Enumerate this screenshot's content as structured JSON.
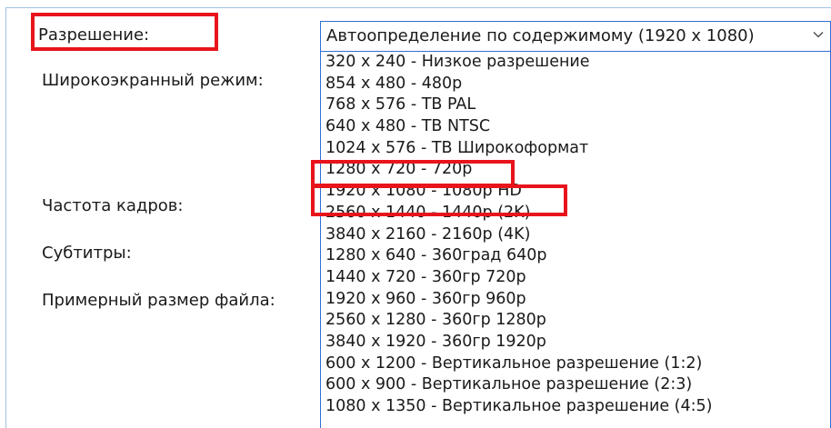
{
  "form": {
    "resolution_label": "Разрешение:",
    "widescreen_label": "Широкоэкранный режим:",
    "framerate_label": "Частота кадров:",
    "subtitles_label": "Субтитры:",
    "filesize_label": "Примерный размер файла:"
  },
  "resolution_select": {
    "selected": "Автоопределение по содержимому (1920 x 1080)",
    "options": [
      "320 x 240 - Низкое разрешение",
      "854 x 480 - 480p",
      "768 x 576 - ТВ PAL",
      "640 x 480 - ТВ NTSC",
      "1024 x 576 - ТВ Широкоформат",
      "1280 x 720 - 720p",
      "1920 x 1080 - 1080p HD",
      "2560 x 1440 - 1440p (2K)",
      "3840 x 2160 - 2160p (4K)",
      "1280 x 640 - 360град 640p",
      "1440 x 720 - 360гр 720p",
      "1920 x 960 - 360гр 960p",
      "2560 x 1280 - 360гр 1280p",
      "3840 x 1920 - 360гр 1920p",
      "600 x 1200 - Вертикальное разрешение (1:2)",
      "600 x 900 - Вертикальное разрешение (2:3)",
      "1080 x 1350 - Вертикальное разрешение (4:5)"
    ]
  },
  "colors": {
    "annotation_red": "#e8141c",
    "control_border_blue": "#2f6fd6",
    "frame_border": "#9ec1e4"
  },
  "icons": {
    "dropdown_arrow": "chevron-down-icon"
  }
}
